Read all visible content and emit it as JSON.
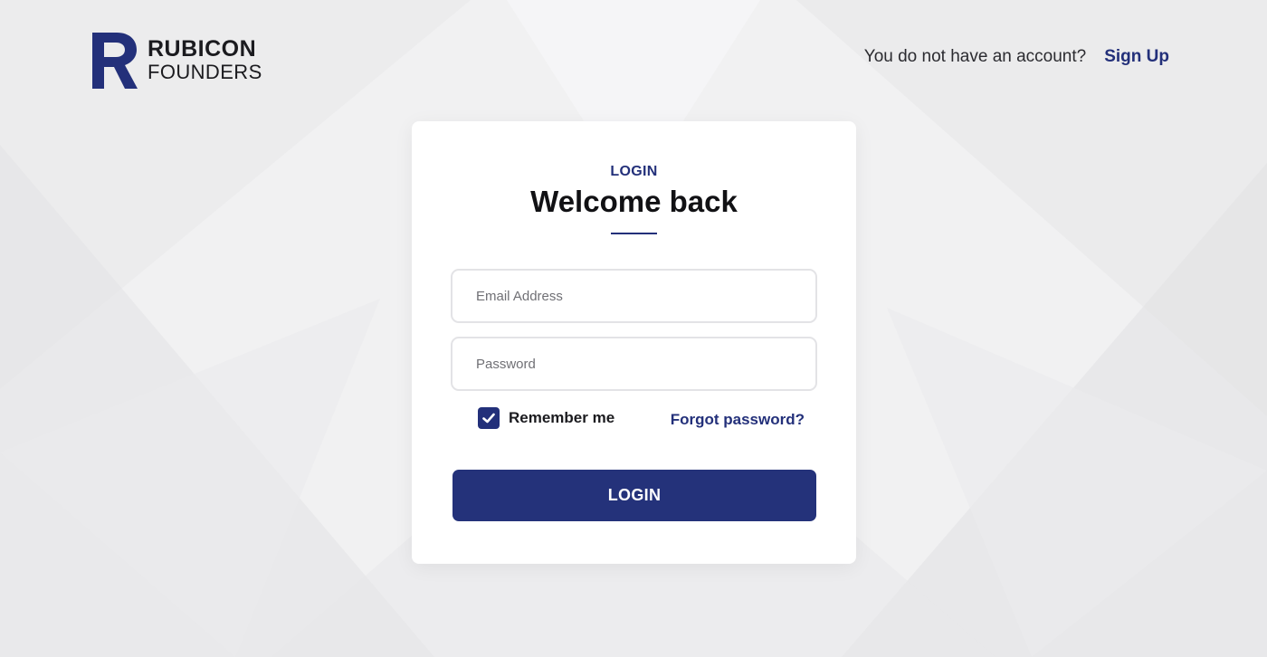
{
  "brand": {
    "name_line1": "RUBICON",
    "name_line2": "FOUNDERS",
    "logo_icon": "r-monogram-logo",
    "color": "#23307a"
  },
  "header": {
    "signup_prompt": "You do not have an account?",
    "signup_link": "Sign Up"
  },
  "card": {
    "eyebrow": "LOGIN",
    "title": "Welcome back"
  },
  "form": {
    "email": {
      "placeholder": "Email Address",
      "value": ""
    },
    "password": {
      "placeholder": "Password",
      "value": ""
    },
    "remember_label": "Remember me",
    "remember_checked": true,
    "forgot_label": "Forgot password?",
    "submit_label": "LOGIN"
  },
  "icons": {
    "checkbox": "checkmark-icon"
  },
  "colors": {
    "accent": "#23307a",
    "background": "#f0f0f1",
    "card": "#ffffff"
  }
}
